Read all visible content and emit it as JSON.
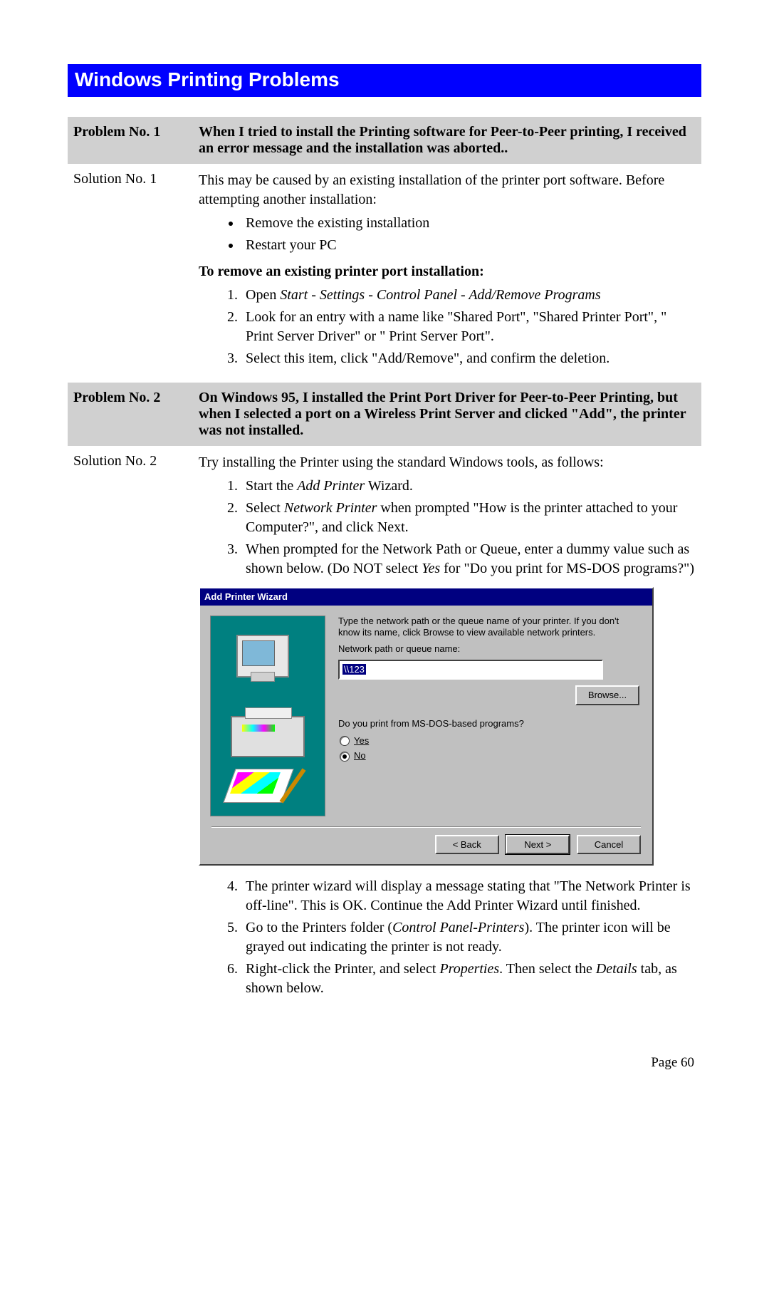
{
  "section_title": "Windows Printing Problems",
  "page_footer": "Page 60",
  "problems": [
    {
      "label": "Problem No. 1",
      "title": "When I tried to install the Printing software for Peer-to-Peer printing, I received an error message and the installation was aborted..",
      "solution_label": "Solution No. 1",
      "intro": "This may be caused by an existing installation of the printer port software. Before attempting another installation:",
      "bullets": [
        "Remove the existing installation",
        "Restart your PC"
      ],
      "sub_heading": "To remove an existing printer port installation:",
      "steps": [
        {
          "pre": "Open ",
          "ital": "Start - Settings - Control Panel - Add/Remove Programs",
          "post": ""
        },
        {
          "pre": "Look for an entry with a name like \"Shared Port\", \"Shared Printer Port\", \" Print Server Driver\" or \" Print Server Port\".",
          "ital": "",
          "post": ""
        },
        {
          "pre": "Select this item, click \"Add/Remove\", and confirm the deletion.",
          "ital": "",
          "post": ""
        }
      ]
    },
    {
      "label": "Problem No. 2",
      "title": "On Windows 95, I installed the Print Port Driver for Peer-to-Peer Printing, but when I selected a port on a Wireless Print Server and clicked \"Add\", the printer was not installed.",
      "solution_label": "Solution No. 2",
      "intro2": "Try installing the Printer using the standard Windows tools, as follows:",
      "steps_a": [
        {
          "pre": "Start the ",
          "ital": "Add Printer",
          "post": " Wizard."
        },
        {
          "pre": "Select ",
          "ital": "Network Printer",
          "post": " when prompted \"How is the printer attached to your Computer?\", and click Next."
        },
        {
          "pre": "When prompted for the Network Path or Queue, enter a dummy value such as shown below. (Do NOT select ",
          "ital": "Yes",
          "post": " for \"Do you print for MS-DOS programs?\")"
        }
      ],
      "wizard": {
        "title": "Add Printer Wizard",
        "desc1": "Type the network path or the queue name of your printer. If you don't know its name, click Browse to view available network printers.",
        "field_label": "Network path or queue name:",
        "field_value": "\\\\123",
        "browse": "Browse...",
        "question": "Do you print from MS-DOS-based programs?",
        "yes": "Yes",
        "no": "No",
        "back": "< Back",
        "next": "Next >",
        "cancel": "Cancel"
      },
      "steps_b": [
        {
          "pre": "The printer wizard will display a message stating that \"The Network Printer is off-line\". This is OK. Continue the Add Printer Wizard until finished.",
          "ital": "",
          "post": ""
        },
        {
          "pre": "Go to the Printers folder (",
          "ital": "Control Panel-Printers",
          "post": "). The printer icon will be grayed out indicating the printer is not ready."
        },
        {
          "pre": "Right-click the Printer, and select ",
          "ital": "Properties",
          "post": ". Then select the ",
          "ital2": "Details",
          "post2": " tab, as shown below."
        }
      ]
    }
  ]
}
